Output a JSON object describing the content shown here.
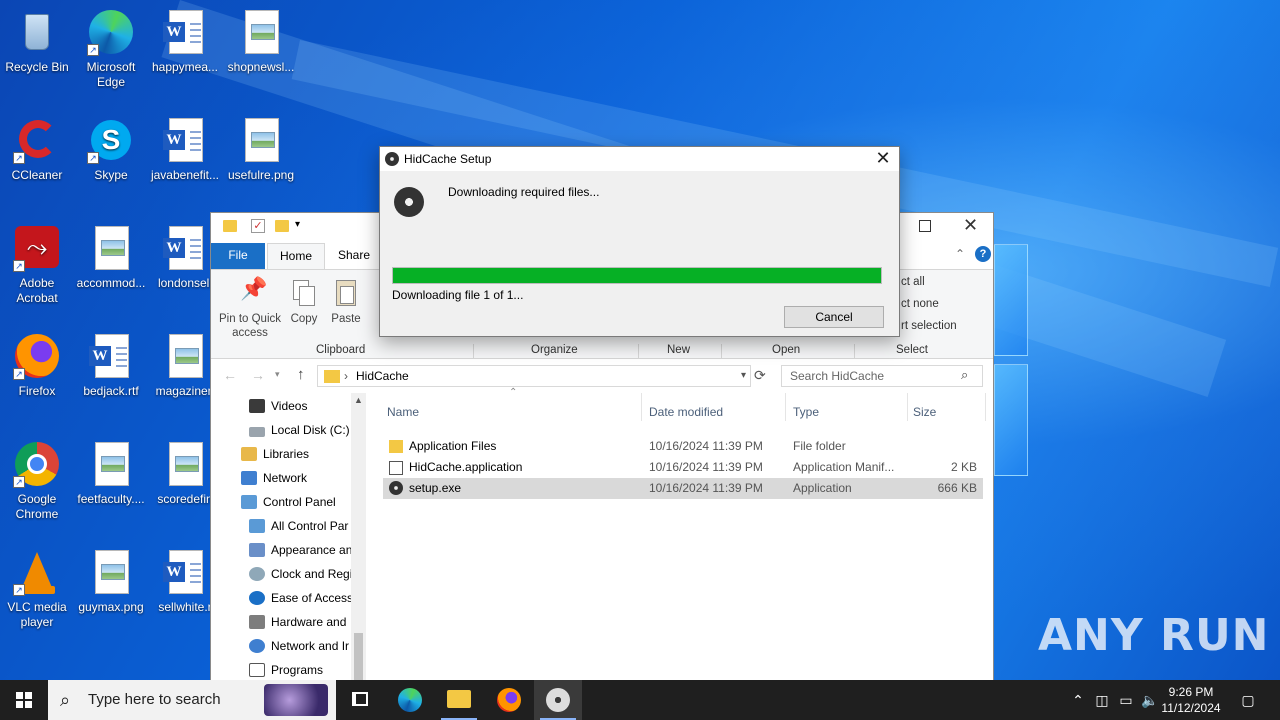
{
  "desktop": {
    "icons": [
      {
        "label": "Recycle Bin",
        "icon": "recycle-bin-icon"
      },
      {
        "label": "Microsoft Edge",
        "icon": "edge-icon"
      },
      {
        "label": "happymea...",
        "icon": "word-doc-icon"
      },
      {
        "label": "shopnewsl...",
        "icon": "image-file-icon"
      },
      {
        "label": "CCleaner",
        "icon": "ccleaner-icon"
      },
      {
        "label": "Skype",
        "icon": "skype-icon"
      },
      {
        "label": "javabenefit...",
        "icon": "word-doc-icon"
      },
      {
        "label": "usefulre.png",
        "icon": "image-file-icon"
      },
      {
        "label": "Adobe Acrobat",
        "icon": "acrobat-icon"
      },
      {
        "label": "accommod...",
        "icon": "image-file-icon"
      },
      {
        "label": "londonsell",
        "icon": "word-doc-icon"
      },
      {
        "label": "Firefox",
        "icon": "firefox-icon"
      },
      {
        "label": "bedjack.rtf",
        "icon": "word-doc-icon"
      },
      {
        "label": "magazinen",
        "icon": "image-file-icon"
      },
      {
        "label": "Google Chrome",
        "icon": "chrome-icon"
      },
      {
        "label": "feetfaculty....",
        "icon": "image-file-icon"
      },
      {
        "label": "scoredefin",
        "icon": "image-file-icon"
      },
      {
        "label": "VLC media player",
        "icon": "vlc-icon"
      },
      {
        "label": "guymax.png",
        "icon": "image-file-icon"
      },
      {
        "label": "sellwhite.r",
        "icon": "word-doc-icon"
      }
    ]
  },
  "explorer": {
    "ribbon_tabs": {
      "file": "File",
      "home": "Home",
      "share": "Share"
    },
    "ribbon_buttons": {
      "pin": "Pin to Quick access",
      "copy": "Copy",
      "paste": "Paste"
    },
    "groups": {
      "clipboard": "Clipboard",
      "organize": "Organize",
      "new": "New",
      "open": "Open",
      "select": "Select"
    },
    "select_items": {
      "all": "ct all",
      "none": "ct none",
      "invert": "rt selection"
    },
    "address": "HidCache",
    "search_placeholder": "Search HidCache",
    "nav_items": [
      {
        "label": "Videos",
        "icon": "videos-folder-icon"
      },
      {
        "label": "Local Disk (C:)",
        "icon": "local-disk-icon"
      },
      {
        "label": "Libraries",
        "icon": "libraries-icon"
      },
      {
        "label": "Network",
        "icon": "network-icon"
      },
      {
        "label": "Control Panel",
        "icon": "control-panel-icon"
      },
      {
        "label": "All Control Par",
        "icon": "control-panel-icon"
      },
      {
        "label": "Appearance an",
        "icon": "appearance-icon"
      },
      {
        "label": "Clock and Regi",
        "icon": "clock-icon"
      },
      {
        "label": "Ease of Access",
        "icon": "ease-of-access-icon"
      },
      {
        "label": "Hardware and",
        "icon": "hardware-icon"
      },
      {
        "label": "Network and Ir",
        "icon": "network-internet-icon"
      },
      {
        "label": "Programs",
        "icon": "programs-icon"
      }
    ],
    "columns": {
      "name": "Name",
      "date": "Date modified",
      "type": "Type",
      "size": "Size"
    },
    "files": [
      {
        "name": "Application Files",
        "date": "10/16/2024 11:39 PM",
        "type": "File folder",
        "size": "",
        "icon": "folder-icon"
      },
      {
        "name": "HidCache.application",
        "date": "10/16/2024 11:39 PM",
        "type": "Application Manif...",
        "size": "2 KB",
        "icon": "application-manifest-icon"
      },
      {
        "name": "setup.exe",
        "date": "10/16/2024 11:39 PM",
        "type": "Application",
        "size": "666 KB",
        "icon": "setup-disc-icon"
      }
    ]
  },
  "setup_dialog": {
    "title": "HidCache Setup",
    "message": "Downloading required files...",
    "progress_percent": 100,
    "status": "Downloading file 1 of 1...",
    "cancel": "Cancel"
  },
  "taskbar": {
    "search_placeholder": "Type here to search",
    "time": "9:26 PM",
    "date": "11/12/2024"
  },
  "watermark": "ANY RUN",
  "colors": {
    "progress": "#06b025",
    "file_tab": "#1a6fc6",
    "taskbar": "#1f1f1f"
  }
}
